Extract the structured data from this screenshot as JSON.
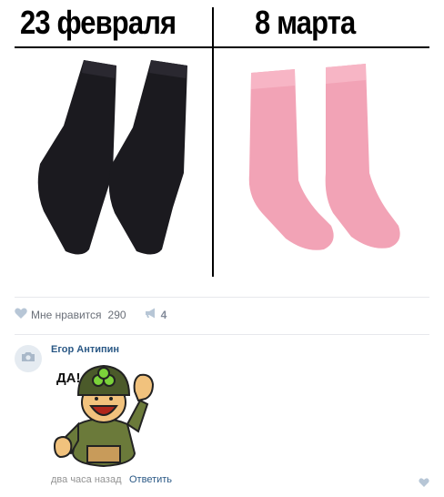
{
  "meme": {
    "left_caption": "23 февраля",
    "right_caption": "8 марта"
  },
  "post_actions": {
    "like_label": "Мне нравится",
    "like_count": "290",
    "share_count": "4"
  },
  "comment": {
    "author": "Егор Антипин",
    "sticker_text": "ДА!",
    "time": "два часа назад",
    "reply_label": "Ответить"
  },
  "colors": {
    "link": "#2a5885",
    "muted": "#6a6f78",
    "icon": "#b7c6d6",
    "black_sock": "#1b1a1f",
    "pink_sock": "#f2a3b6"
  },
  "icons": [
    "heart-icon",
    "megaphone-icon",
    "camera-icon",
    "like-heart-icon"
  ]
}
